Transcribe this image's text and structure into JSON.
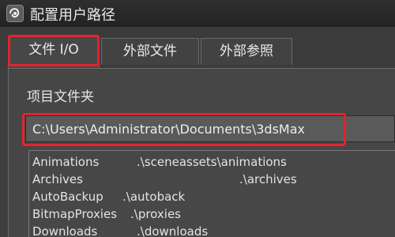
{
  "window": {
    "title": "配置用户路径",
    "icon": "3ds-max-app-icon"
  },
  "tabs": [
    {
      "label": "文件 I/O",
      "active": true
    },
    {
      "label": "外部文件",
      "active": false
    },
    {
      "label": "外部参照",
      "active": false
    }
  ],
  "section": {
    "label": "项目文件夹"
  },
  "project_path": {
    "value": "C:\\Users\\Administrator\\Documents\\3dsMax"
  },
  "paths": [
    {
      "name": "Animations",
      "path": ".\\sceneassets\\animations"
    },
    {
      "name": "Archives",
      "path": ".\\archives"
    },
    {
      "name": "AutoBackup",
      "path": ".\\autoback"
    },
    {
      "name": "BitmapProxies",
      "path": ".\\proxies"
    },
    {
      "name": "Downloads",
      "path": ".\\downloads"
    }
  ],
  "colors": {
    "highlight": "#e3232e",
    "background": "#3f3f3f"
  }
}
